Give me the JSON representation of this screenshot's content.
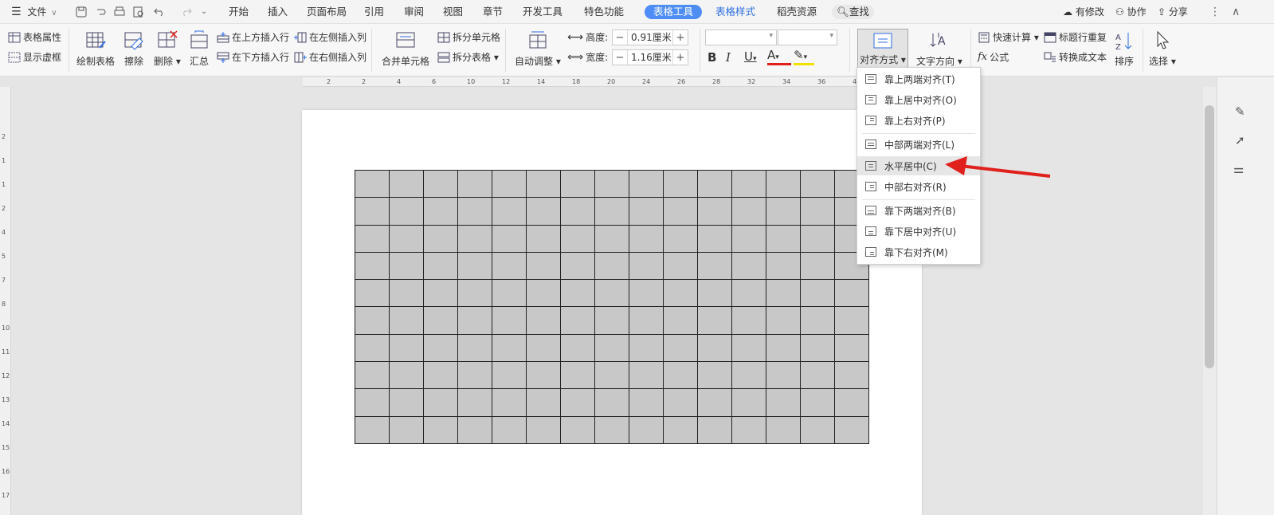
{
  "menubar": {
    "file_label": "文件",
    "tabs": [
      "开始",
      "插入",
      "页面布局",
      "引用",
      "审阅",
      "视图",
      "章节",
      "开发工具",
      "特色功能",
      "表格工具",
      "表格样式",
      "稻壳资源"
    ],
    "active_tab": "表格工具",
    "search_label": "查找",
    "right": {
      "modify": "有修改",
      "collab": "协作",
      "share": "分享"
    }
  },
  "ribbon": {
    "table_props": "表格属性",
    "show_gridlines": "显示虚框",
    "draw_table": "绘制表格",
    "erase": "擦除",
    "delete": "删除",
    "summary": "汇总",
    "insert_above": "在上方插入行",
    "insert_below": "在下方插入行",
    "insert_left": "在左侧插入列",
    "insert_right": "在右侧插入列",
    "merge_cells": "合并单元格",
    "split_cells": "拆分单元格",
    "split_table": "拆分表格",
    "auto_fit": "自动调整",
    "height_label": "高度:",
    "height_value": "0.91厘米",
    "width_label": "宽度:",
    "width_value": "1.16厘米",
    "align": "对齐方式",
    "text_direction": "文字方向",
    "quick_calc": "快速计算",
    "formula": "公式",
    "header_repeat": "标题行重复",
    "to_text": "转换成文本",
    "sort": "排序",
    "select": "选择"
  },
  "ruler_top": [
    "2",
    "2",
    "4",
    "6",
    "10",
    "12",
    "14",
    "18",
    "20",
    "24",
    "26",
    "28",
    "32",
    "34",
    "36",
    "40"
  ],
  "ruler_left": [
    "2",
    "1",
    "1",
    "2",
    "4",
    "5",
    "7",
    "8",
    "10",
    "11",
    "12",
    "13",
    "14",
    "15",
    "16",
    "17",
    "18"
  ],
  "table": {
    "rows": 10,
    "cols": 15
  },
  "dropdown": {
    "items": [
      "靠上两端对齐(T)",
      "靠上居中对齐(O)",
      "靠上右对齐(P)",
      "中部两端对齐(L)",
      "水平居中(C)",
      "中部右对齐(R)",
      "靠下两端对齐(B)",
      "靠下居中对齐(U)",
      "靠下右对齐(M)"
    ],
    "highlighted": "水平居中(C)"
  },
  "colors": {
    "accent": "#4e8df5",
    "arrow": "#e0201c",
    "cell_fill": "#c8c8c8"
  }
}
